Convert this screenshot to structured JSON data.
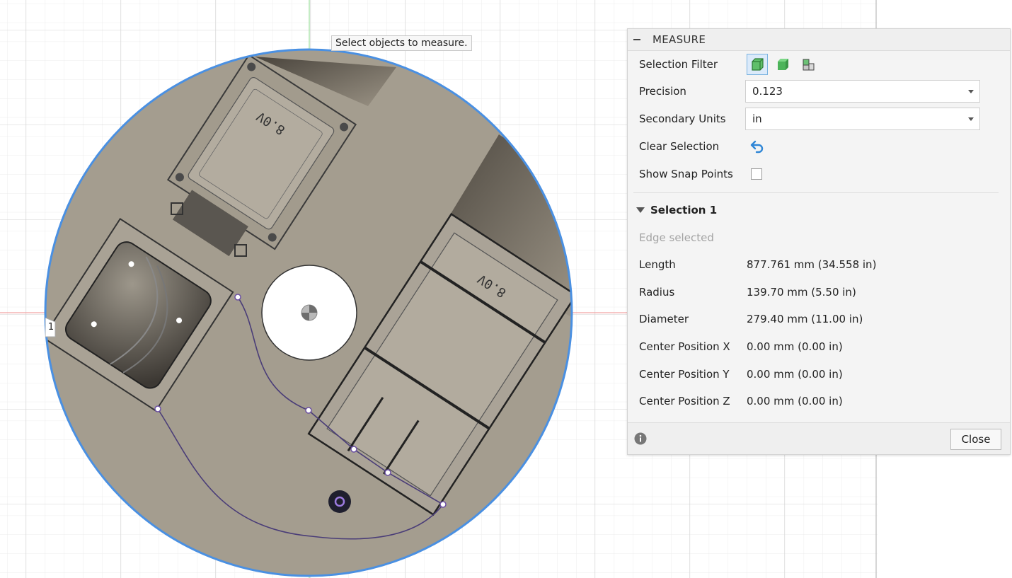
{
  "viewport": {
    "tooltip": "Select objects to measure.",
    "edge_marker": "1",
    "component_labels": [
      "8.0V",
      "8.0V"
    ]
  },
  "measure_panel": {
    "title": "MEASURE",
    "selection_filter": {
      "label": "Selection Filter",
      "icons": [
        "body-filter-icon",
        "face-filter-icon",
        "component-filter-icon"
      ]
    },
    "precision": {
      "label": "Precision",
      "value": "0.123"
    },
    "secondary_units": {
      "label": "Secondary Units",
      "value": "in"
    },
    "clear_selection": {
      "label": "Clear Selection"
    },
    "show_snap_points": {
      "label": "Show Snap Points",
      "checked": false
    },
    "selection": {
      "title": "Selection 1",
      "status": "Edge selected",
      "rows": [
        {
          "label": "Length",
          "value": "877.761 mm (34.558 in)"
        },
        {
          "label": "Radius",
          "value": "139.70 mm (5.50 in)"
        },
        {
          "label": "Diameter",
          "value": "279.40 mm (11.00 in)"
        },
        {
          "label": "Center Position X",
          "value": "0.00 mm (0.00 in)"
        },
        {
          "label": "Center Position Y",
          "value": "0.00 mm (0.00 in)"
        },
        {
          "label": "Center Position Z",
          "value": "0.00 mm (0.00 in)"
        }
      ]
    },
    "close_label": "Close"
  },
  "colors": {
    "accent": "#3c8fd8",
    "disc": "#a49d8f",
    "selection_edge": "#4a90e2",
    "axis_red": "#f2a3a3",
    "axis_green": "#9ee09e"
  }
}
